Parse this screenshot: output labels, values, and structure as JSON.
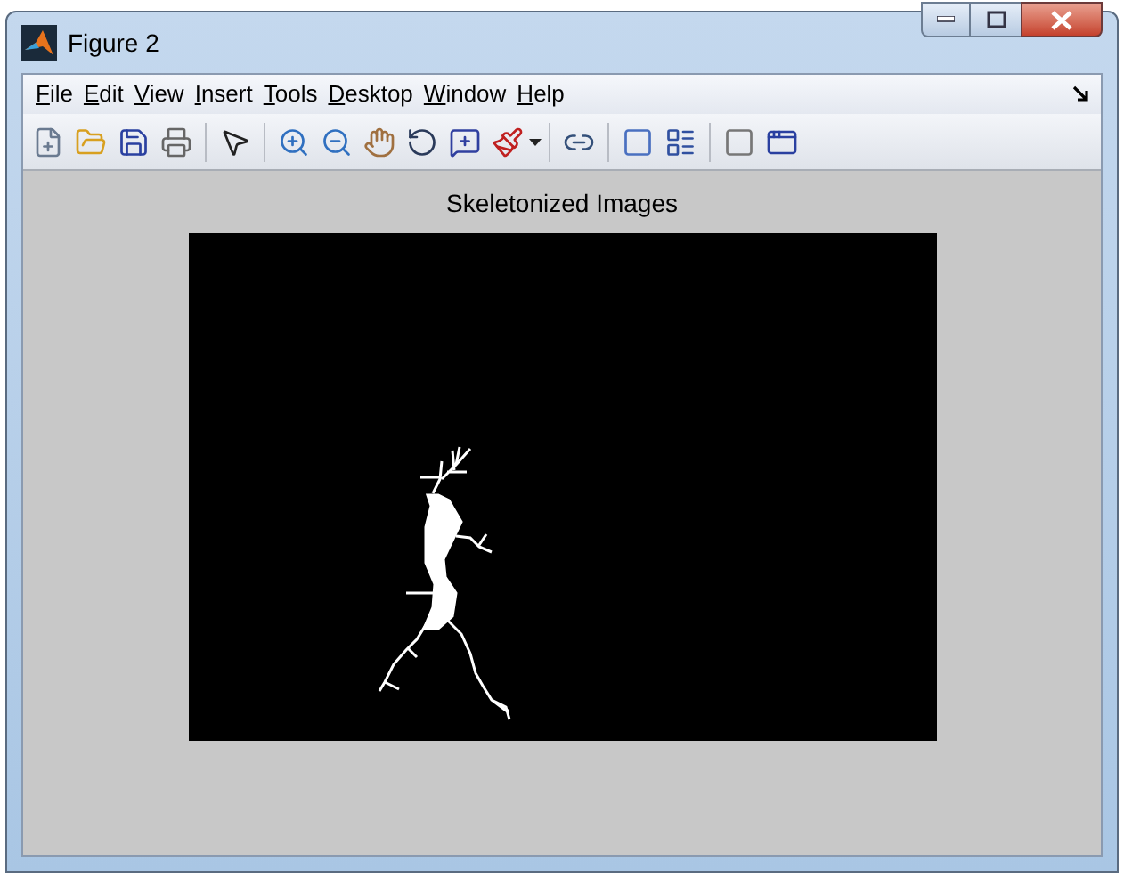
{
  "window": {
    "title": "Figure 2"
  },
  "menu": [
    "File",
    "Edit",
    "View",
    "Insert",
    "Tools",
    "Desktop",
    "Window",
    "Help"
  ],
  "figure": {
    "title": "Skeletonized Images"
  }
}
